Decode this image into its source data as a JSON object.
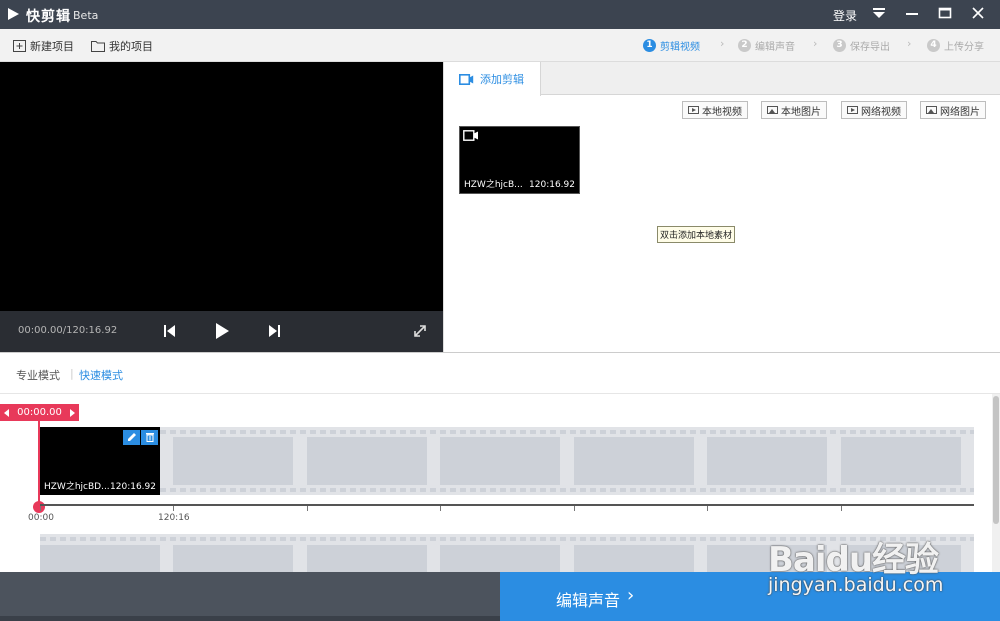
{
  "titlebar": {
    "app_name": "快剪辑",
    "beta": "Beta",
    "login": "登录"
  },
  "toolbar": {
    "new_project": "新建项目",
    "my_projects": "我的项目",
    "steps": [
      {
        "num": "1",
        "label": "剪辑视频",
        "active": true
      },
      {
        "num": "2",
        "label": "编辑声音",
        "active": false
      },
      {
        "num": "3",
        "label": "保存导出",
        "active": false
      },
      {
        "num": "4",
        "label": "上传分享",
        "active": false
      }
    ]
  },
  "player": {
    "time": "00:00.00/120:16.92"
  },
  "media": {
    "tab": "添加剪辑",
    "sources": [
      "本地视频",
      "本地图片",
      "网络视频",
      "网络图片"
    ],
    "clip": {
      "name": "HZW之hjcB...",
      "duration": "120:16.92"
    },
    "hint": "双击添加本地素材"
  },
  "modes": {
    "pro": "专业模式",
    "quick": "快速模式"
  },
  "timeline": {
    "playhead": "00:00.00",
    "clip": {
      "name": "HZW之hjcBD...",
      "duration": "120:16.92"
    },
    "ticks": [
      "00:00",
      "120:16"
    ]
  },
  "next": {
    "label": "编辑声音"
  },
  "watermark": {
    "logo": "Baidu经验",
    "url": "jingyan.baidu.com"
  },
  "colors": {
    "accent": "#2b8de2",
    "playhead": "#e8395a",
    "titlebar": "#3c4450"
  }
}
